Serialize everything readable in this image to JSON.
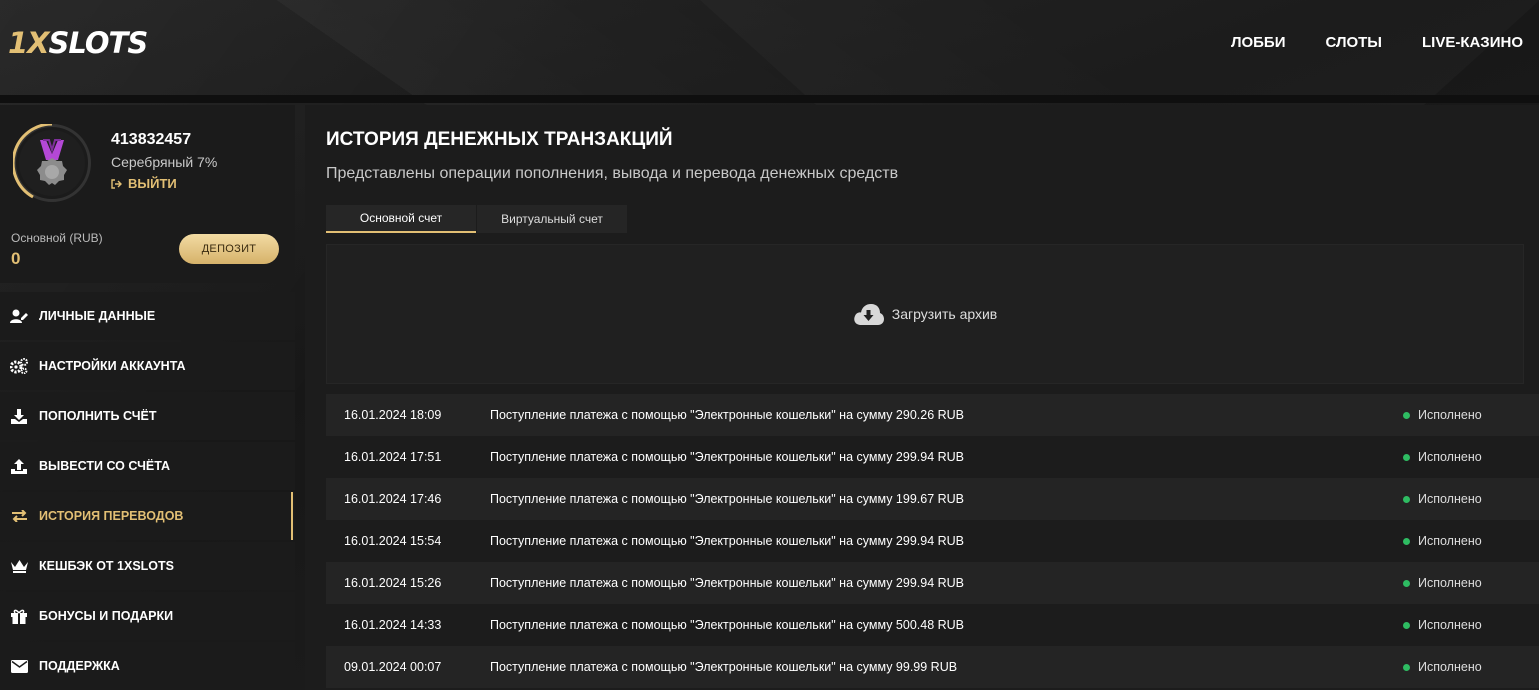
{
  "header": {
    "logo_part1": "1X",
    "logo_part2": "SLOTS",
    "nav": [
      "ЛОББИ",
      "СЛОТЫ",
      "LIVE-КАЗИНО"
    ]
  },
  "profile": {
    "user_id": "413832457",
    "level": "Серебряный 7%",
    "logout": "ВЫЙТИ",
    "balance_label": "Основной (RUB)",
    "balance_value": "0",
    "deposit": "ДЕПОЗИТ"
  },
  "menu": [
    {
      "label": "ЛИЧНЫЕ ДАННЫЕ",
      "icon": "user-edit-icon",
      "active": false
    },
    {
      "label": "НАСТРОЙКИ АККАУНТА",
      "icon": "gears-icon",
      "active": false
    },
    {
      "label": "ПОПОЛНИТЬ СЧЁТ",
      "icon": "download-icon",
      "active": false
    },
    {
      "label": "ВЫВЕСТИ СО СЧЁТА",
      "icon": "upload-icon",
      "active": false
    },
    {
      "label": "ИСТОРИЯ ПЕРЕВОДОВ",
      "icon": "transfer-arrows-icon",
      "active": true
    },
    {
      "label": "КЕШБЭК ОТ 1XSLOTS",
      "icon": "crown-icon",
      "active": false
    },
    {
      "label": "БОНУСЫ И ПОДАРКИ",
      "icon": "gift-icon",
      "active": false
    },
    {
      "label": "ПОДДЕРЖКА",
      "icon": "envelope-icon",
      "active": false
    }
  ],
  "main": {
    "title": "ИСТОРИЯ ДЕНЕЖНЫХ ТРАНЗАКЦИЙ",
    "subtitle": "Представлены операции пополнения, вывода и перевода денежных средств",
    "tabs": [
      "Основной счет",
      "Виртуальный счет"
    ],
    "archive_label": "Загрузить архив",
    "transactions": [
      {
        "date": "16.01.2024 18:09",
        "desc": "Поступление платежа с помощью \"Электронные кошельки\" на сумму 290.26 RUB",
        "status": "Исполнено"
      },
      {
        "date": "16.01.2024 17:51",
        "desc": "Поступление платежа с помощью \"Электронные кошельки\" на сумму 299.94 RUB",
        "status": "Исполнено"
      },
      {
        "date": "16.01.2024 17:46",
        "desc": "Поступление платежа с помощью \"Электронные кошельки\" на сумму 199.67 RUB",
        "status": "Исполнено"
      },
      {
        "date": "16.01.2024 15:54",
        "desc": "Поступление платежа с помощью \"Электронные кошельки\" на сумму 299.94 RUB",
        "status": "Исполнено"
      },
      {
        "date": "16.01.2024 15:26",
        "desc": "Поступление платежа с помощью \"Электронные кошельки\" на сумму 299.94 RUB",
        "status": "Исполнено"
      },
      {
        "date": "16.01.2024 14:33",
        "desc": "Поступление платежа с помощью \"Электронные кошельки\" на сумму 500.48 RUB",
        "status": "Исполнено"
      },
      {
        "date": "09.01.2024 00:07",
        "desc": "Поступление платежа с помощью \"Электронные кошельки\" на сумму 99.99 RUB",
        "status": "Исполнено"
      }
    ]
  },
  "colors": {
    "accent": "#e2bf74",
    "status_ok": "#2ebc62",
    "background": "#161616"
  }
}
